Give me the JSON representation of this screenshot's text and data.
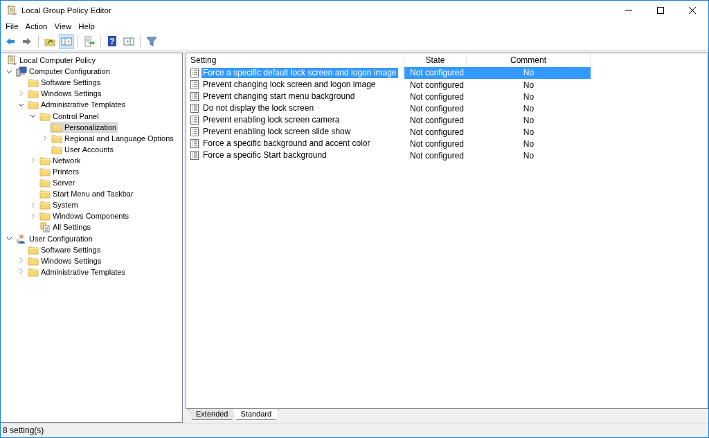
{
  "window": {
    "title": "Local Group Policy Editor"
  },
  "menu": [
    "File",
    "Action",
    "View",
    "Help"
  ],
  "toolbar": [
    {
      "kind": "back",
      "pressed": false
    },
    {
      "kind": "forward",
      "pressed": false
    },
    {
      "kind": "sep"
    },
    {
      "kind": "up",
      "pressed": false
    },
    {
      "kind": "tree",
      "pressed": true
    },
    {
      "kind": "sep"
    },
    {
      "kind": "export",
      "pressed": false
    },
    {
      "kind": "sep"
    },
    {
      "kind": "help",
      "glyph": "?",
      "pressed": false
    },
    {
      "kind": "pane",
      "pressed": false
    },
    {
      "kind": "sep"
    },
    {
      "kind": "filter",
      "pressed": false
    }
  ],
  "tree": {
    "label": "Local Computer Policy",
    "kind": "policy",
    "selected": false,
    "children": [
      {
        "label": "Computer Configuration",
        "kind": "computer",
        "expanded": true,
        "selected": false,
        "children": [
          {
            "label": "Software Settings",
            "kind": "folder",
            "selected": false
          },
          {
            "label": "Windows Settings",
            "kind": "folder",
            "expanded": false,
            "selected": false
          },
          {
            "label": "Administrative Templates",
            "kind": "folder",
            "expanded": true,
            "selected": false,
            "children": [
              {
                "label": "Control Panel",
                "kind": "folder",
                "expanded": true,
                "selected": false,
                "children": [
                  {
                    "label": "Personalization",
                    "kind": "folder",
                    "selected": true
                  },
                  {
                    "label": "Regional and Language Options",
                    "kind": "folder",
                    "expanded": false,
                    "selected": false
                  },
                  {
                    "label": "User Accounts",
                    "kind": "folder",
                    "selected": false
                  }
                ]
              },
              {
                "label": "Network",
                "kind": "folder",
                "expanded": false,
                "selected": false
              },
              {
                "label": "Printers",
                "kind": "folder",
                "selected": false
              },
              {
                "label": "Server",
                "kind": "folder",
                "selected": false
              },
              {
                "label": "Start Menu and Taskbar",
                "kind": "folder",
                "selected": false
              },
              {
                "label": "System",
                "kind": "folder",
                "expanded": false,
                "selected": false
              },
              {
                "label": "Windows Components",
                "kind": "folder",
                "expanded": false,
                "selected": false
              },
              {
                "label": "All Settings",
                "kind": "allsettings",
                "selected": false
              }
            ]
          }
        ]
      },
      {
        "label": "User Configuration",
        "kind": "user",
        "expanded": true,
        "selected": false,
        "children": [
          {
            "label": "Software Settings",
            "kind": "folder",
            "selected": false
          },
          {
            "label": "Windows Settings",
            "kind": "folder",
            "expanded": false,
            "selected": false
          },
          {
            "label": "Administrative Templates",
            "kind": "folder",
            "expanded": false,
            "selected": false
          }
        ]
      }
    ]
  },
  "table": {
    "columns": [
      "Setting",
      "State",
      "Comment"
    ],
    "rows": [
      {
        "setting": "Force a specific default lock screen and logon image",
        "state": "Not configured",
        "comment": "No",
        "selected": true
      },
      {
        "setting": "Prevent changing lock screen and logon image",
        "state": "Not configured",
        "comment": "No",
        "selected": false
      },
      {
        "setting": "Prevent changing start menu background",
        "state": "Not configured",
        "comment": "No",
        "selected": false
      },
      {
        "setting": "Do not display the lock screen",
        "state": "Not configured",
        "comment": "No",
        "selected": false
      },
      {
        "setting": "Prevent enabling lock screen camera",
        "state": "Not configured",
        "comment": "No",
        "selected": false
      },
      {
        "setting": "Prevent enabling lock screen slide show",
        "state": "Not configured",
        "comment": "No",
        "selected": false
      },
      {
        "setting": "Force a specific background and accent color",
        "state": "Not configured",
        "comment": "No",
        "selected": false
      },
      {
        "setting": "Force a specific Start background",
        "state": "Not configured",
        "comment": "No",
        "selected": false
      }
    ]
  },
  "tabs": [
    {
      "label": "Extended",
      "selected": false
    },
    {
      "label": "Standard",
      "selected": true
    }
  ],
  "status_bar": "8 setting(s)"
}
